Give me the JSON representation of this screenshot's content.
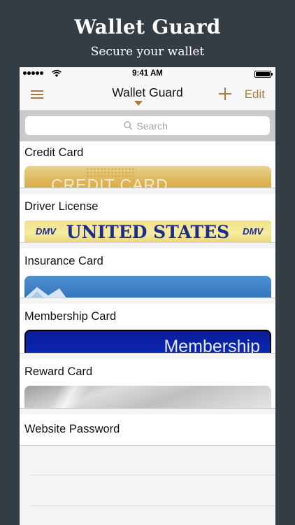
{
  "promo": {
    "title": "Wallet Guard",
    "subtitle": "Secure your wallet"
  },
  "status_bar": {
    "time": "9:41 AM"
  },
  "nav": {
    "title": "Wallet Guard",
    "edit_label": "Edit"
  },
  "search": {
    "placeholder": "Search"
  },
  "rows": [
    {
      "label": "Credit Card",
      "card_text": "CREDIT CARD"
    },
    {
      "label": "Driver License",
      "card_text": "UNITED STATES",
      "card_tag": "DMV"
    },
    {
      "label": "Insurance Card"
    },
    {
      "label": "Membership Card",
      "card_text": "Membership"
    },
    {
      "label": "Reward Card"
    },
    {
      "label": "Website Password"
    }
  ],
  "colors": {
    "accent": "#a87a3e",
    "background": "#353d44",
    "credit_card": "#dcb556",
    "license_text": "#1b2c8c",
    "insurance_card": "#2f6fb6",
    "membership_card": "#0a1c9c",
    "reward_card": "#c8c8c8"
  }
}
